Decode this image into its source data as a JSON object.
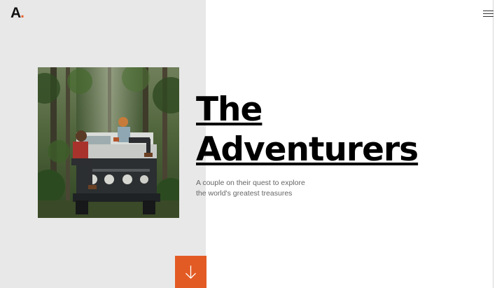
{
  "brand": {
    "logo_letter": "A",
    "logo_dot": ".",
    "accent_color": "#e35b24"
  },
  "nav": {
    "menu_icon": "hamburger-menu-icon"
  },
  "hero": {
    "title_line_1": "The",
    "title_line_2": "Adventurers",
    "tagline_line_1": "A couple on their quest to explore",
    "tagline_line_2": "the world's greatest treasures",
    "image_description_icon": "photo",
    "scroll_icon": "arrow-down-icon"
  },
  "colors": {
    "left_panel": "#e8e8e8",
    "text": "#000000",
    "muted_text": "#666666"
  }
}
